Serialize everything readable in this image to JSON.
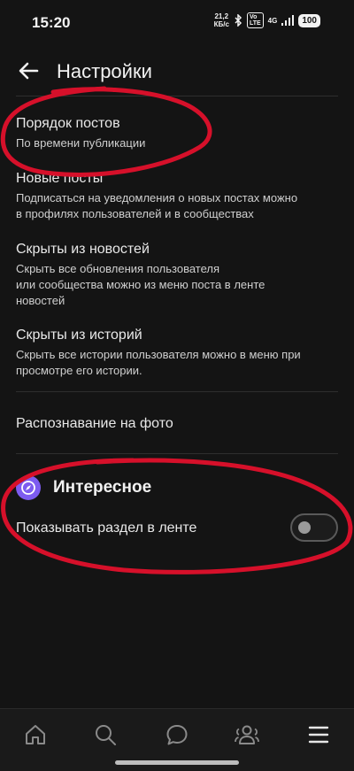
{
  "status_bar": {
    "time": "15:20",
    "speed_value": "21,2",
    "speed_unit": "КБ/с",
    "volte_top": "Vo",
    "volte_bottom": "LTE",
    "network": "4G",
    "battery": "100"
  },
  "header": {
    "title": "Настройки"
  },
  "settings": [
    {
      "title": "Порядок постов",
      "subtitle": "По времени публикации"
    },
    {
      "title": "Новые посты",
      "subtitle": "Подписаться на уведомления о новых постах можно\nв профилях пользователей и в сообществах"
    },
    {
      "title": "Скрыты из новостей",
      "subtitle": "Скрыть все обновления пользователя\nили сообщества можно из меню поста в ленте\nновостей"
    },
    {
      "title": "Скрыты из историй",
      "subtitle": "Скрыть все истории пользователя можно в меню при\nпросмотре его истории."
    },
    {
      "title": "Распознавание на фото",
      "subtitle": ""
    }
  ],
  "interesting": {
    "title": "Интересное",
    "toggle_label": "Показывать раздел в ленте",
    "toggle_on": false
  },
  "colors": {
    "accent": "#7d5cf0",
    "annotation": "#d6102a",
    "background": "#141414"
  },
  "bottom_nav": {
    "icons": [
      "home-icon",
      "search-icon",
      "messages-icon",
      "friends-icon",
      "menu-icon"
    ]
  }
}
